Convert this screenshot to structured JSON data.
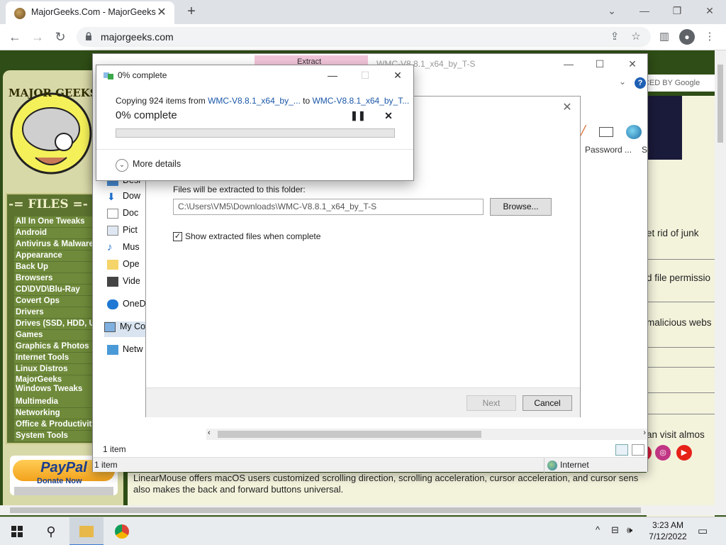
{
  "browser": {
    "tab_title": "MajorGeeks.Com - MajorGeeks",
    "url": "majorgeeks.com",
    "new_tab_symbol": "+",
    "tab_close_symbol": "✕"
  },
  "page": {
    "logo_text": "MAJOR GEEKS",
    "files_heading": "-= FILES =-",
    "categories": [
      "All In One Tweaks",
      "Android",
      "Antivirus & Malware",
      "Appearance",
      "Back Up",
      "Browsers",
      "CD\\DVD\\Blu-Ray",
      "Covert Ops",
      "Drivers",
      "Drives (SSD, HDD, USB)",
      "Games",
      "Graphics & Photos",
      "Internet Tools",
      "Linux Distros",
      "MajorGeeks Windows Tweaks",
      "Multimedia",
      "Networking",
      "Office & Productivity",
      "System Tools"
    ],
    "paypal": "PayPal",
    "paypal_donate": "Donate Now",
    "google_badge": "NCED BY Google",
    "right_snippets": [
      "et rid of junk",
      "d file permissio",
      "malicious webs",
      "an visit almos"
    ],
    "bottom_text_1": "LinearMouse offers macOS users customized scrolling direction, scrolling acceleration, cursor acceleration, and cursor sens",
    "bottom_text_2": "also makes the back and forward buttons universal."
  },
  "zip_window": {
    "title": "WMC-V8.8.1_x64_by_T-S",
    "pink_tab": "Extract",
    "nav_items": [
      "Desktop",
      "Downloads",
      "Documents",
      "Pictures",
      "Music",
      "Open",
      "Videos",
      "OneDrive",
      "My Computer",
      "Network"
    ],
    "nav_visible": [
      "Desl",
      "Dow",
      "Doc",
      "Pict",
      "Mus",
      "Ope",
      "Vide",
      "OneD",
      "My Co",
      "Netw"
    ],
    "password_label": "Password ...",
    "si_label": "Si",
    "status_items": "1 item",
    "status_items2": "1 item",
    "zone": "Internet"
  },
  "wizard": {
    "folder_label": "Files will be extracted to this folder:",
    "folder_path": "C:\\Users\\VM5\\Downloads\\WMC-V8.8.1_x64_by_T-S",
    "browse_label": "Browse...",
    "show_files_label": "Show extracted files when complete",
    "show_files_checked": true,
    "next_label": "Next",
    "cancel_label": "Cancel"
  },
  "progress_dialog": {
    "title": "0% complete",
    "copy_prefix": "Copying 924 items from ",
    "copy_source": "WMC-V8.8.1_x64_by_...",
    "copy_mid": " to ",
    "copy_dest": "WMC-V8.8.1_x64_by_T...",
    "percent_text": "0% complete",
    "progress_fraction": 0.0,
    "more_details": "More details"
  },
  "taskbar": {
    "time": "3:23 AM",
    "date": "7/12/2022"
  }
}
